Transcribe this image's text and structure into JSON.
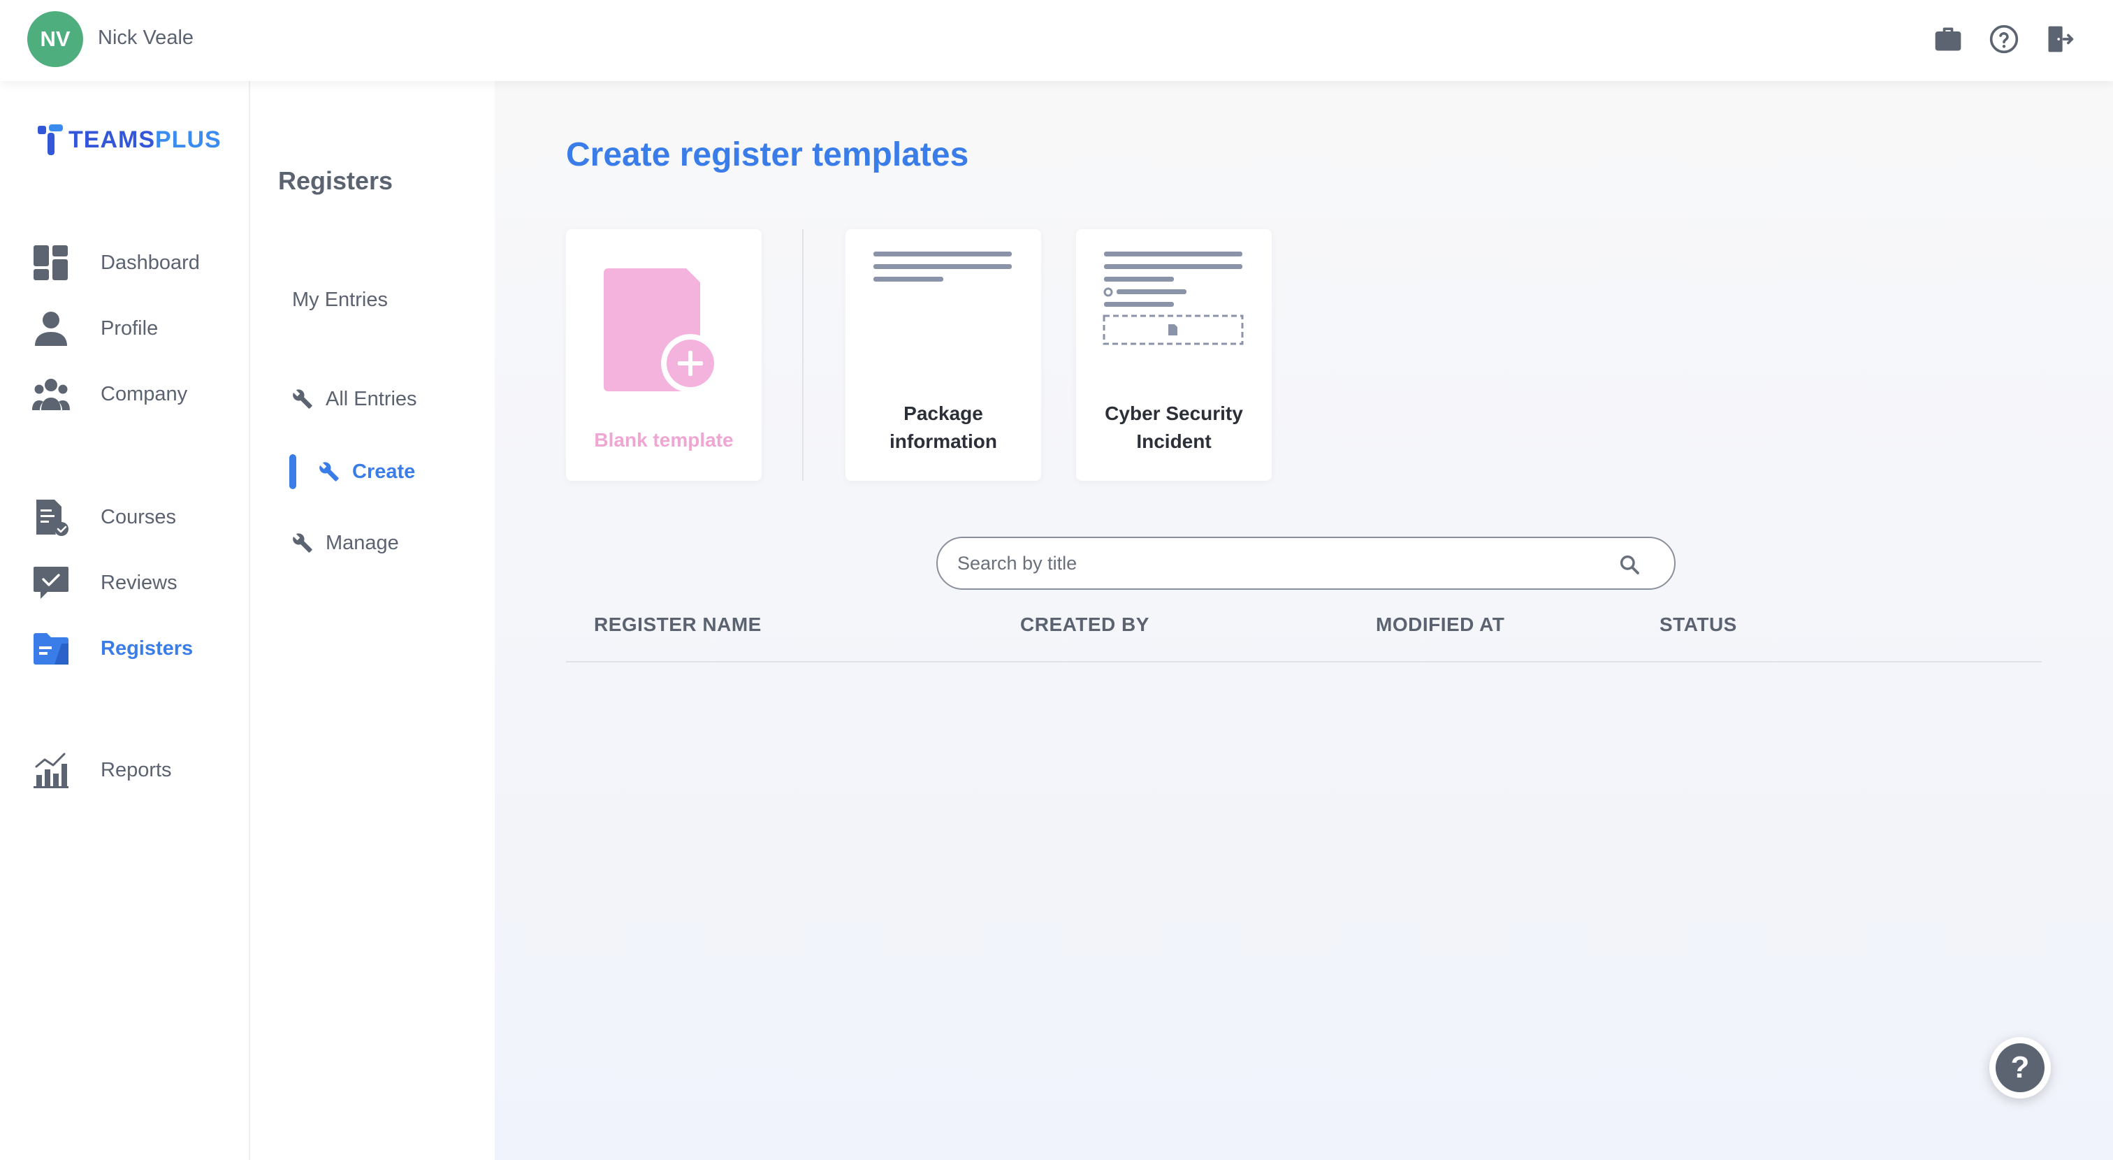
{
  "user": {
    "initials": "NV",
    "name": "Nick Veale"
  },
  "colors": {
    "accent": "#3b7de8",
    "avatar": "#4fae7e",
    "blank_template": "#f0a6d2",
    "icon_gray": "#5c6472"
  },
  "top_icons": [
    "briefcase-icon",
    "help-circle-icon",
    "logout-icon"
  ],
  "logo": {
    "part1": "TEAMS",
    "part2": "PLUS"
  },
  "sidebar": {
    "items": [
      {
        "label": "Dashboard",
        "icon": "dashboard-icon"
      },
      {
        "label": "Profile",
        "icon": "person-icon"
      },
      {
        "label": "Company",
        "icon": "group-icon"
      },
      {
        "label": "Courses",
        "icon": "course-document-icon"
      },
      {
        "label": "Reviews",
        "icon": "review-chat-icon"
      },
      {
        "label": "Registers",
        "icon": "folder-icon",
        "active": true
      },
      {
        "label": "Reports",
        "icon": "bar-chart-icon"
      }
    ]
  },
  "subnav": {
    "title": "Registers",
    "items": [
      {
        "label": "My Entries"
      },
      {
        "label": "All Entries",
        "icon": "wrench-icon"
      },
      {
        "label": "Create",
        "icon": "wrench-icon",
        "active": true
      },
      {
        "label": "Manage",
        "icon": "wrench-icon"
      }
    ]
  },
  "main": {
    "title": "Create register templates",
    "templates": [
      {
        "label": "Blank template"
      },
      {
        "label": "Package information"
      },
      {
        "label": "Cyber Security Incident"
      }
    ],
    "search": {
      "placeholder": "Search by title",
      "value": ""
    },
    "table": {
      "columns": [
        "REGISTER NAME",
        "CREATED BY",
        "MODIFIED AT",
        "STATUS"
      ],
      "rows": []
    }
  },
  "help_fab": {
    "label": "?"
  }
}
